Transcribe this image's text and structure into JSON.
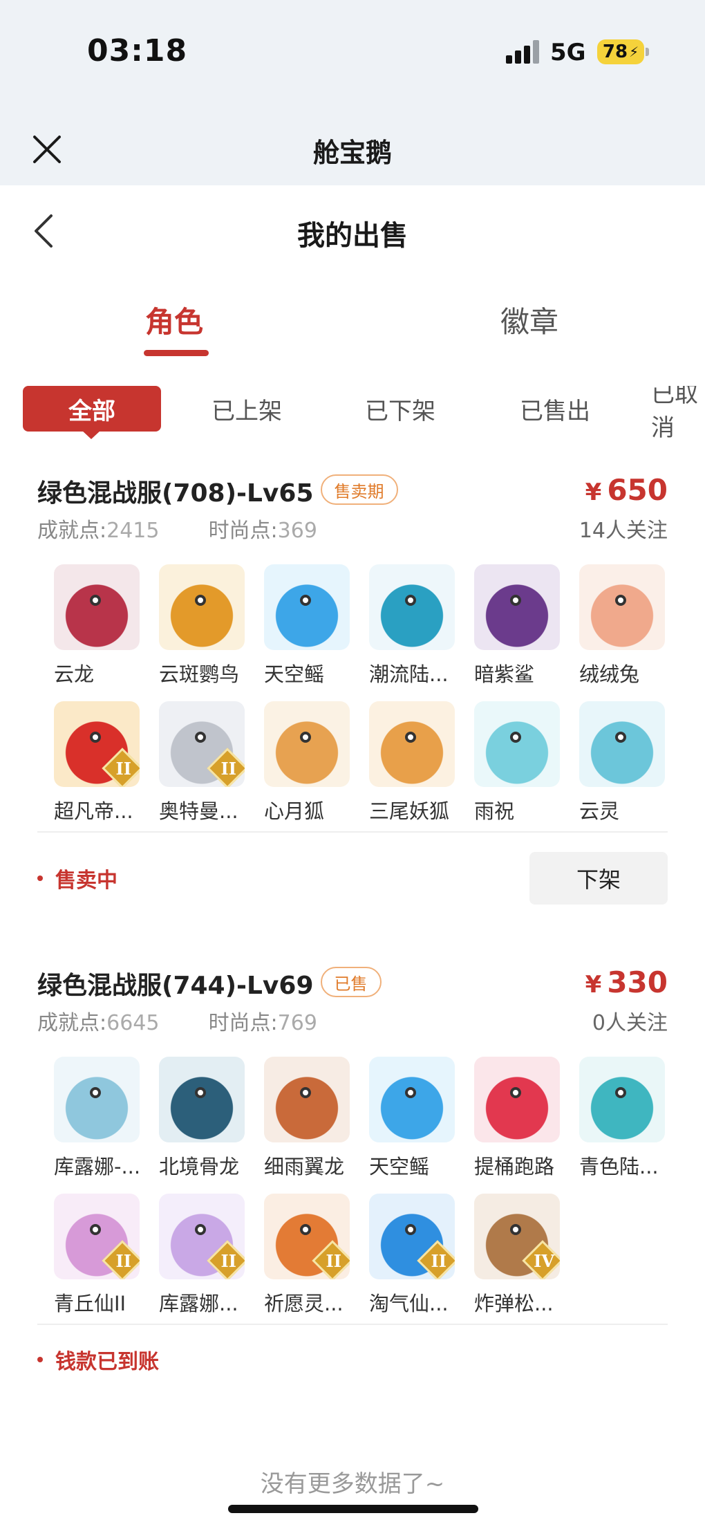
{
  "status_bar": {
    "time": "03:18",
    "network": "5G",
    "battery": "78"
  },
  "app_bar": {
    "title": "舱宝鹅",
    "close_icon": "close-icon"
  },
  "nav": {
    "title": "我的出售",
    "back_icon": "chevron-left-icon"
  },
  "tabs": [
    {
      "label": "角色",
      "active": true
    },
    {
      "label": "徽章",
      "active": false
    }
  ],
  "filters": [
    {
      "label": "全部",
      "active": true
    },
    {
      "label": "已上架",
      "active": false
    },
    {
      "label": "已下架",
      "active": false
    },
    {
      "label": "已售出",
      "active": false
    },
    {
      "label": "已取消",
      "active": false
    }
  ],
  "listings": [
    {
      "title": "绿色混战服(708)-Lv65",
      "badge": "售卖期",
      "price_symbol": "¥",
      "price": "650",
      "achievement_label": "成就点:",
      "achievement_value": "2415",
      "fashion_label": "时尚点:",
      "fashion_value": "369",
      "followers": "14人关注",
      "status": "售卖中",
      "action_label": "下架",
      "items": [
        {
          "name": "云龙",
          "color": "#b8344a",
          "bg": "#f4e7ea"
        },
        {
          "name": "云斑鹦鸟",
          "color": "#e39a2a",
          "bg": "#fbf1dc"
        },
        {
          "name": "天空鳐",
          "color": "#3da6e8",
          "bg": "#e6f5fd"
        },
        {
          "name": "潮流陆...",
          "color": "#2aa0c2",
          "bg": "#eef7fb"
        },
        {
          "name": "暗紫鲨",
          "color": "#6b3b8c",
          "bg": "#ece5f2"
        },
        {
          "name": "绒绒兔",
          "color": "#f0a98c",
          "bg": "#fbefe8"
        },
        {
          "name": "超凡帝...",
          "color": "#d9302a",
          "bg": "#fbe9c8",
          "rank": "II"
        },
        {
          "name": "奥特曼...",
          "color": "#c0c4cc",
          "bg": "#eef0f4",
          "rank": "II"
        },
        {
          "name": "心月狐",
          "color": "#e7a251",
          "bg": "#fbf2e4"
        },
        {
          "name": "三尾妖狐",
          "color": "#e8a04a",
          "bg": "#fcf1e1"
        },
        {
          "name": "雨祝",
          "color": "#7ad0de",
          "bg": "#eaf8fa"
        },
        {
          "name": "云灵",
          "color": "#6cc6da",
          "bg": "#e8f6fa"
        }
      ]
    },
    {
      "title": "绿色混战服(744)-Lv69",
      "badge": "已售",
      "price_symbol": "¥",
      "price": "330",
      "achievement_label": "成就点:",
      "achievement_value": "6645",
      "fashion_label": "时尚点:",
      "fashion_value": "769",
      "followers": "0人关注",
      "status": "钱款已到账",
      "items": [
        {
          "name": "库露娜-...",
          "color": "#8fc7dd",
          "bg": "#eef6fa"
        },
        {
          "name": "北境骨龙",
          "color": "#2c5f7a",
          "bg": "#e3eef3"
        },
        {
          "name": "细雨翼龙",
          "color": "#c96a3a",
          "bg": "#f7ece4"
        },
        {
          "name": "天空鳐",
          "color": "#3da6e8",
          "bg": "#e6f5fd"
        },
        {
          "name": "提桶跑路",
          "color": "#e2384f",
          "bg": "#fbe6ea"
        },
        {
          "name": "青色陆...",
          "color": "#3fb6c0",
          "bg": "#eaf7f8"
        },
        {
          "name": "青丘仙II",
          "color": "#d79ad8",
          "bg": "#f8ecf8",
          "rank": "II"
        },
        {
          "name": "库露娜...",
          "color": "#c9a8e6",
          "bg": "#f4eefb",
          "rank": "II"
        },
        {
          "name": "祈愿灵...",
          "color": "#e37b35",
          "bg": "#fbeee3",
          "rank": "II"
        },
        {
          "name": "淘气仙...",
          "color": "#2f8fe0",
          "bg": "#e4f1fc",
          "rank": "II"
        },
        {
          "name": "炸弹松...",
          "color": "#b07a4a",
          "bg": "#f5ece3",
          "rank": "IV"
        }
      ]
    }
  ],
  "footer": {
    "no_more": "没有更多数据了~"
  }
}
